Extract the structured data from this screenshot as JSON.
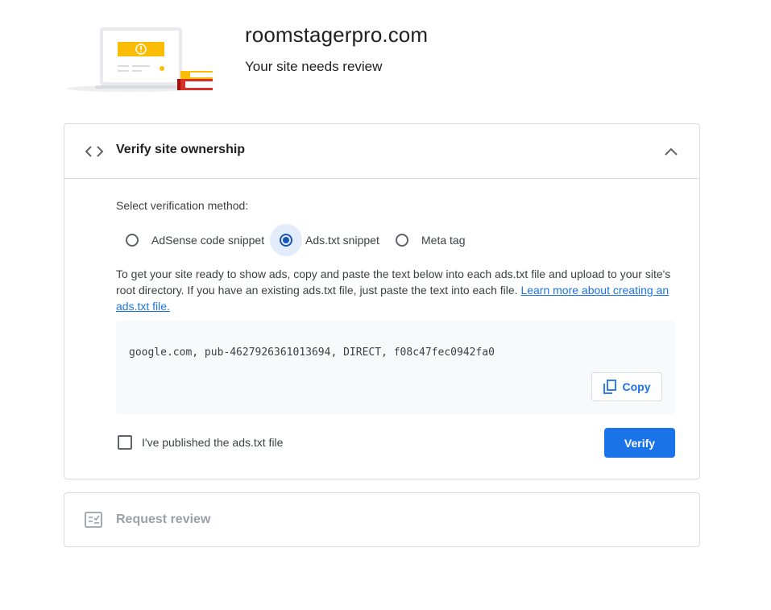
{
  "header": {
    "site_name": "roomstagerpro.com",
    "status": "Your site needs review"
  },
  "verify_card": {
    "title": "Verify site ownership",
    "method_label": "Select verification method:",
    "methods": [
      {
        "label": "AdSense code snippet",
        "selected": false
      },
      {
        "label": "Ads.txt snippet",
        "selected": true
      },
      {
        "label": "Meta tag",
        "selected": false
      }
    ],
    "description": "To get your site ready to show ads, copy and paste the text below into each ads.txt file and upload to your site's root directory. If you have an existing ads.txt file, just paste the text into each file. ",
    "learn_more_link": "Learn more about creating an ads.txt file.",
    "ads_txt_line": "google.com, pub-4627926361013694, DIRECT, f08c47fec0942fa0",
    "copy_label": "Copy",
    "checkbox_label": "I've published the ads.txt file",
    "checkbox_checked": false,
    "verify_label": "Verify"
  },
  "review_card": {
    "title": "Request review",
    "disabled": true
  },
  "colors": {
    "accent": "#1a73e8",
    "radio_selected": "#1a56b4",
    "illustration_yellow": "#fbbc04",
    "illustration_red": "#d93025"
  }
}
